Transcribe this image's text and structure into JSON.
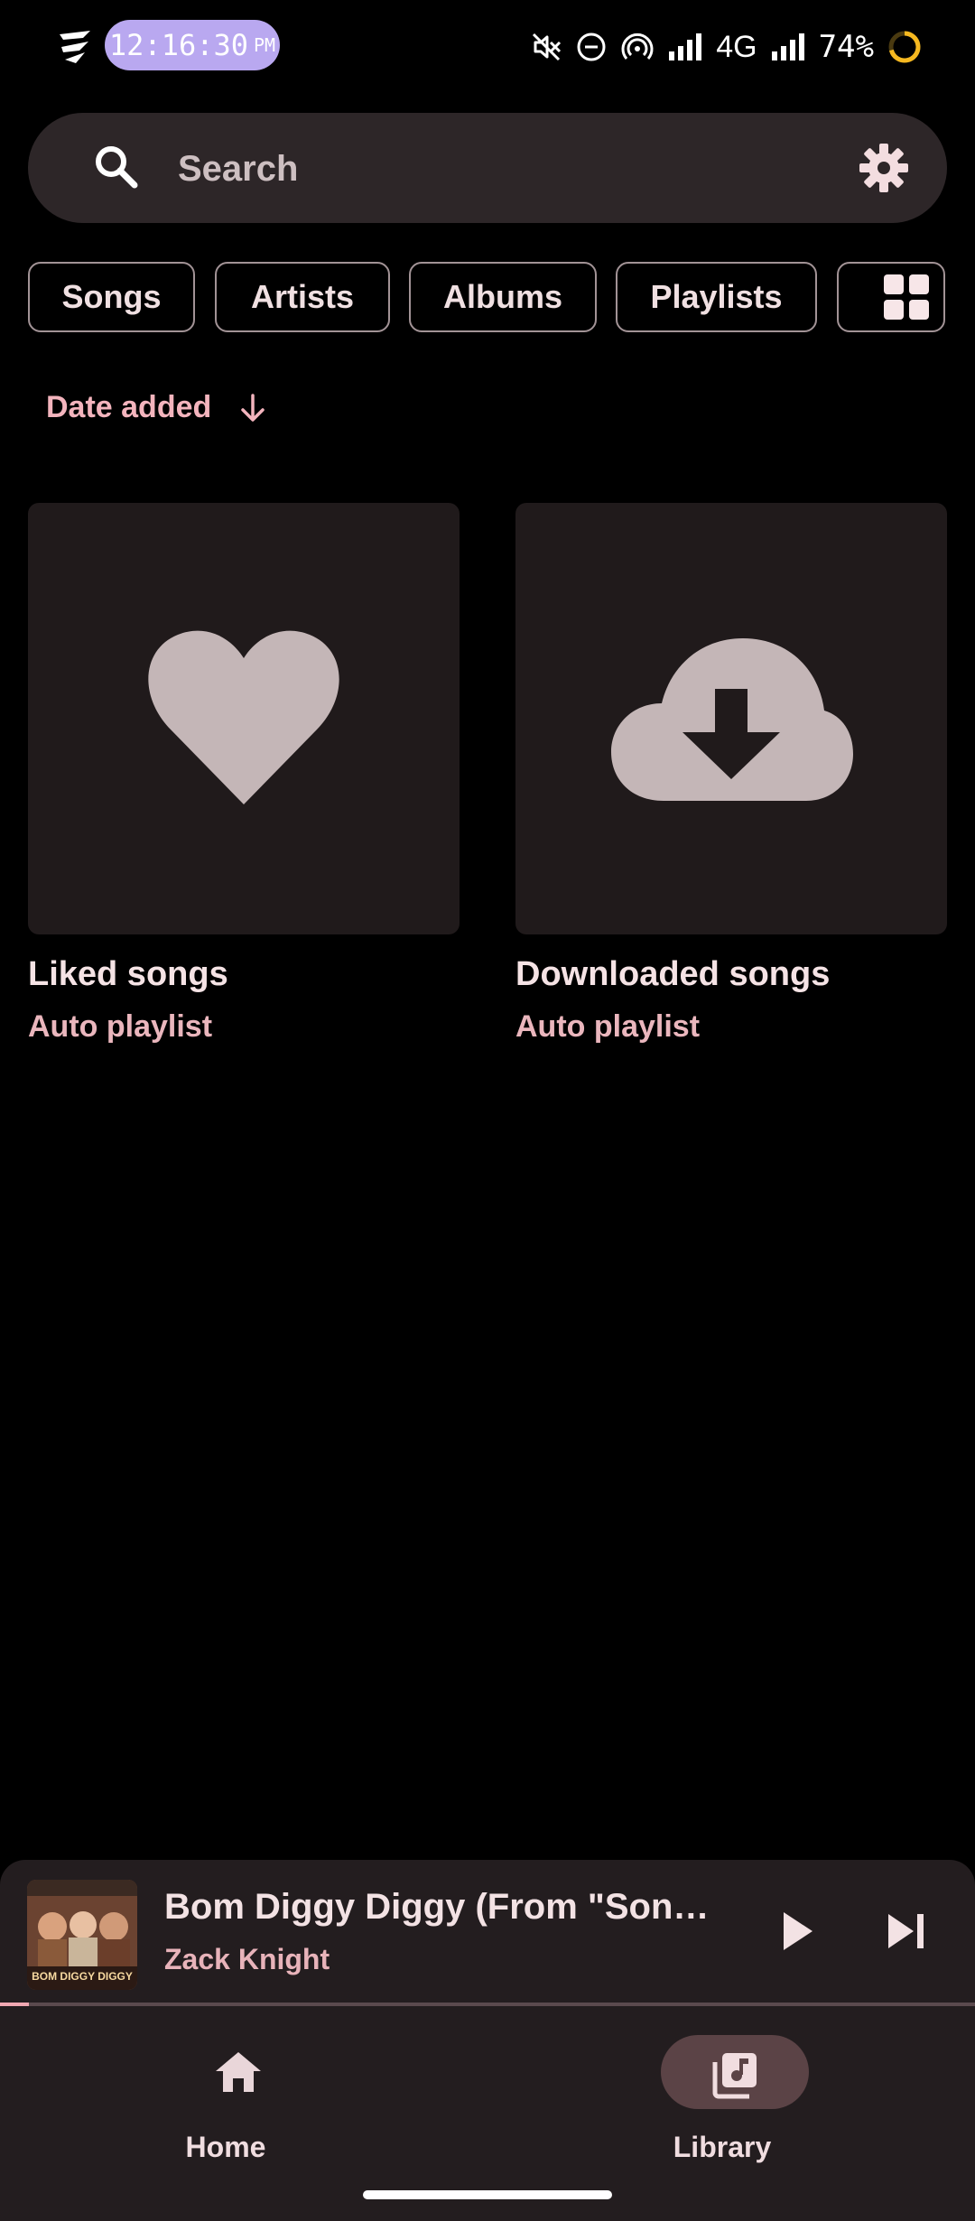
{
  "status_bar": {
    "time": "12:16:30",
    "ampm": "PM",
    "network": "4G",
    "battery": "74%",
    "battery_level": 0.74,
    "icons": [
      "app-logo-icon",
      "mute-icon",
      "dnd-icon",
      "hotspot-icon",
      "signal-icon",
      "signal-icon-2",
      "battery-ring-icon"
    ]
  },
  "search": {
    "placeholder": "Search",
    "icon": "search-icon",
    "settings_icon": "gear-icon"
  },
  "filters": {
    "chips": [
      "Songs",
      "Artists",
      "Albums",
      "Playlists"
    ],
    "layout_toggle_icon": "grid-view-icon"
  },
  "sort": {
    "label": "Date added",
    "direction_icon": "arrow-down-icon"
  },
  "playlists": [
    {
      "title": "Liked songs",
      "subtitle": "Auto playlist",
      "icon": "heart-icon"
    },
    {
      "title": "Downloaded songs",
      "subtitle": "Auto playlist",
      "icon": "cloud-download-icon"
    }
  ],
  "mini_player": {
    "title": "Bom Diggy Diggy (From \"Sonu Ke Titu Ki Sweety\")",
    "artist": "Zack Knight",
    "album_art_text": "BOM DIGGY DIGGY",
    "progress": 0.03
  },
  "nav": {
    "items": [
      {
        "label": "Home",
        "icon": "home-icon",
        "active": false
      },
      {
        "label": "Library",
        "icon": "library-music-icon",
        "active": true
      }
    ]
  },
  "colors": {
    "background": "#000000",
    "surface": "#231d1f",
    "accent": "#f3b4bd",
    "time_pill": "#b9a8f0"
  }
}
